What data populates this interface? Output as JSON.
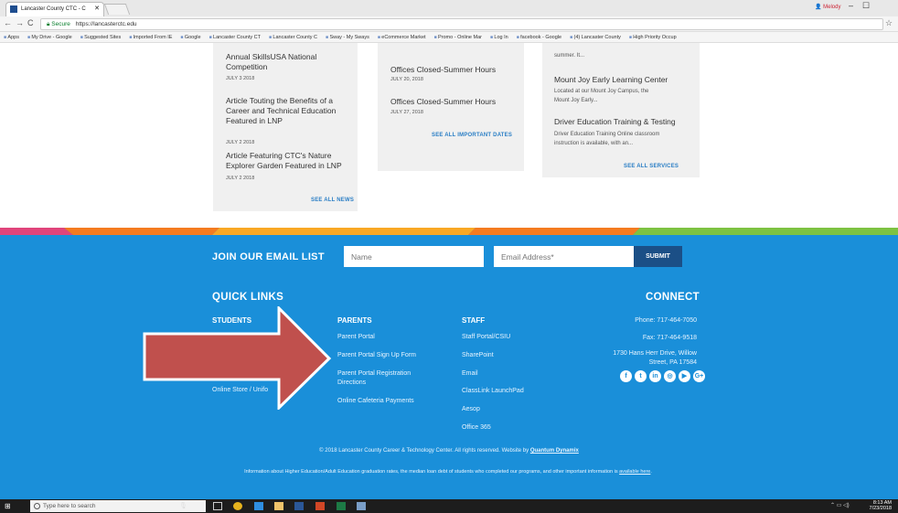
{
  "browser": {
    "tab_title": "Lancaster County CTC - C",
    "profile_name": "Melody",
    "secure_label": "Secure",
    "url": "https://lancasterctc.edu",
    "bookmarks": [
      "Apps",
      "My Drive - Google",
      "Suggested Sites",
      "Imported From IE",
      "Google",
      "Lancaster County CT",
      "Lancaster County C",
      "Sway - My Sways",
      "eCommerce Market",
      "Promo - Online Mar",
      "Log In",
      "facebook - Google",
      "(4) Lancaster County",
      "High Priority Occup"
    ]
  },
  "news": {
    "items": [
      {
        "title": "Annual SkillsUSA National Competition",
        "date": "JULY 3 2018"
      },
      {
        "title": "Article Touting the Benefits of a Career and Technical Education Featured in LNP",
        "date": "JULY 2 2018"
      },
      {
        "title": "Article Featuring CTC's Nature Explorer Garden Featured in LNP",
        "date": "JULY 2 2018"
      }
    ],
    "see_all": "SEE ALL NEWS"
  },
  "dates": {
    "items": [
      {
        "title": "Offices Closed-Summer Hours",
        "date": "JULY 20, 2018"
      },
      {
        "title": "Offices Closed-Summer Hours",
        "date": "JULY 27, 2018"
      }
    ],
    "see_all": "SEE ALL IMPORTANT DATES"
  },
  "services": {
    "top_text": "summer. It...",
    "items": [
      {
        "title": "Mount Joy Early Learning Center",
        "desc1": "Located at our Mount Joy Campus, the",
        "desc2": "Mount Joy Early..."
      },
      {
        "title": "Driver Education Training & Testing",
        "desc1": "Driver Education Training Online classroom",
        "desc2": "instruction is available, with an..."
      }
    ],
    "see_all": "SEE ALL SERVICES"
  },
  "email_signup": {
    "label": "JOIN OUR EMAIL LIST",
    "name_placeholder": "Name",
    "email_placeholder": "Email Address*",
    "submit": "SUBMIT"
  },
  "footer": {
    "quick_links": "QUICK LINKS",
    "connect": "CONNECT",
    "students": {
      "heading": "STUDENTS",
      "links": [
        "Online Store / Unifo"
      ]
    },
    "parents": {
      "heading": "PARENTS",
      "links": [
        "Parent Portal",
        "Parent Portal Sign Up Form",
        "Parent Portal Registration",
        "Directions",
        "Online Cafeteria Payments"
      ]
    },
    "staff": {
      "heading": "STAFF",
      "links": [
        "Staff Portal/CSIU",
        "SharePoint",
        "Email",
        "ClassLink LaunchPad",
        "Aesop",
        "Office 365"
      ]
    },
    "contact": {
      "phone": "Phone: 717-464-7050",
      "fax": "Fax: 717-464-9518",
      "address1": "1730 Hans Herr Drive, Willow",
      "address2": "Street, PA 17584"
    },
    "social": [
      "f",
      "t",
      "in",
      "◎",
      "▶",
      "G+"
    ],
    "copyright_prefix": "© 2018 Lancaster County Career & Technology Center. All rights reserved. Website by",
    "copyright_link": "Quantum Dynamix",
    "info_text": "Information about Higher Education/Adult Education graduation rates, the median loan debt of students who completed our programs, and other important information is",
    "info_link": "available here"
  },
  "taskbar": {
    "search_placeholder": "Type here to search",
    "time": "8:13 AM",
    "date": "7/23/2018"
  },
  "colors": {
    "footer_bg": "#1a8fd9",
    "submit_bg": "#1b4f86",
    "link_blue": "#2a7ec5",
    "arrow_red": "#c0504d"
  }
}
